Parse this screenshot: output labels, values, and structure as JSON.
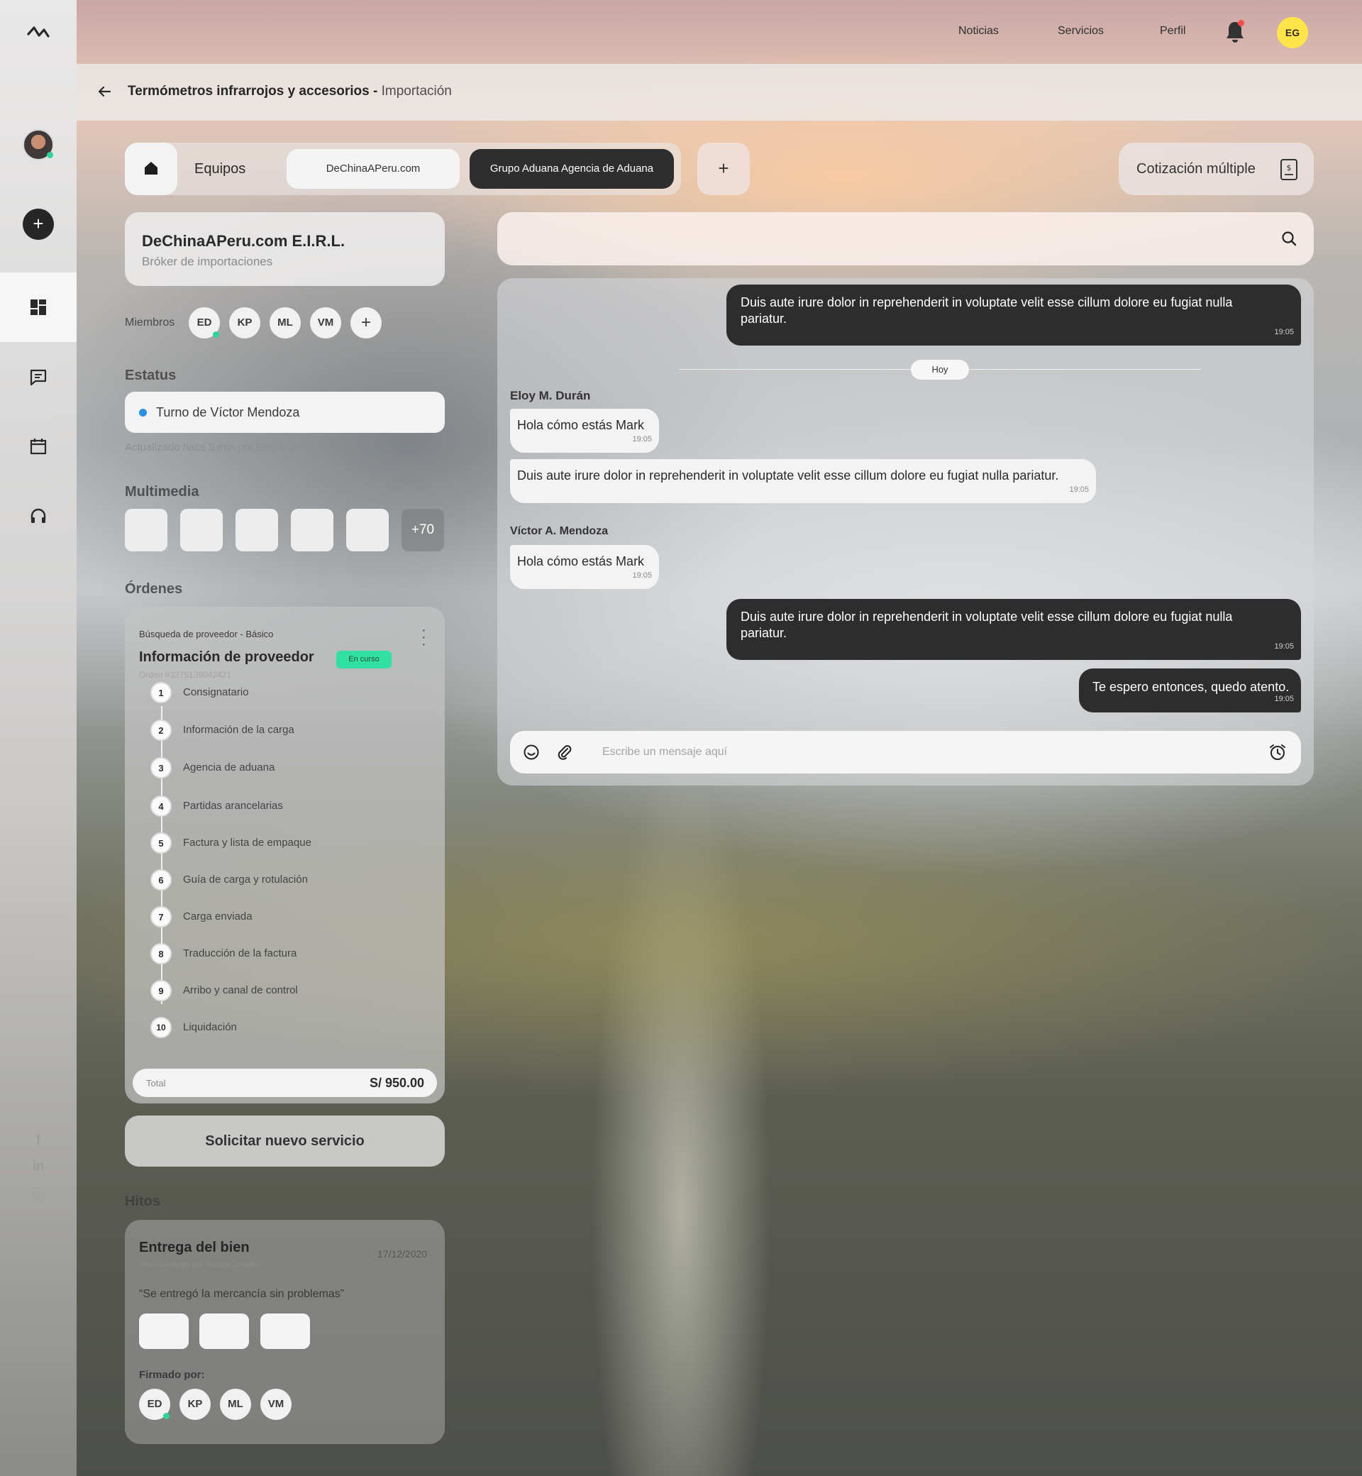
{
  "nav": {
    "links": [
      "Noticias",
      "Servicios",
      "Perfil"
    ],
    "user_initials": "EG",
    "bell_icon": "bell-icon"
  },
  "breadcrumb": {
    "title": "Termómetros infrarrojos y accesorios -",
    "subtitle": "Importación"
  },
  "tabs": {
    "group_label": "Equipos",
    "items": [
      "DeChinaAPeru.com",
      "Grupo Aduana Agencia de Aduana"
    ],
    "active_index": 1,
    "multi_quote_label": "Cotización múltiple"
  },
  "company": {
    "name": "DeChinaAPeru.com E.I.R.L.",
    "role": "Bróker de importaciones"
  },
  "members": {
    "label": "Miembros",
    "initials": [
      "ED",
      "KP",
      "ML",
      "VM"
    ]
  },
  "status": {
    "heading": "Estatus",
    "value": "Turno de Víctor Mendoza",
    "updated": "Actualizado hace 5 min por Eloy Durán"
  },
  "media": {
    "heading": "Multimedia",
    "more_count": "+70"
  },
  "orders": {
    "heading": "Órdenes",
    "category": "Búsqueda de proveedor - Básico",
    "title": "Información de proveedor",
    "badge": "En curso",
    "order_number": "Orden #3275139042421",
    "steps": [
      {
        "n": "1",
        "label": "Consignatario"
      },
      {
        "n": "2",
        "label": "Información de la carga"
      },
      {
        "n": "3",
        "label": "Agencia de aduana"
      },
      {
        "n": "4",
        "label": "Partidas arancelarias"
      },
      {
        "n": "5",
        "label": "Factura y lista de empaque"
      },
      {
        "n": "6",
        "label": "Guía de carga y rotulación"
      },
      {
        "n": "7",
        "label": "Carga enviada"
      },
      {
        "n": "8",
        "label": "Traducción de la factura"
      },
      {
        "n": "9",
        "label": "Arribo y canal de control"
      },
      {
        "n": "10",
        "label": "Liquidación"
      }
    ],
    "total_label": "Total",
    "total_value": "S/ 950.00"
  },
  "request_button": "Solicitar nuevo servicio",
  "milestones": {
    "heading": "Hitos",
    "title": "Entrega del bien",
    "date": "17/12/2020",
    "meta": "Hito #1 creado por Julissa Zevallos",
    "quote": "“Se entregó la mercancía sin problemas”",
    "signed_label": "Firmado por:",
    "signers": [
      "ED",
      "KP",
      "ML",
      "VM"
    ]
  },
  "chat": {
    "search_placeholder": "",
    "today_label": "Hoy",
    "messages": [
      {
        "dir": "out",
        "text": "Duis aute irure dolor in reprehenderit in voluptate velit esse cillum dolore eu fugiat nulla pariatur.",
        "time": "19:05"
      },
      {
        "dir": "in",
        "sender": "Eloy M. Durán",
        "text": "Hola cómo estás Mark",
        "time": "19:05"
      },
      {
        "dir": "in",
        "text": "Duis aute irure dolor in reprehenderit in voluptate velit esse cillum dolore eu fugiat nulla pariatur.",
        "time": "19:05"
      },
      {
        "dir": "in",
        "sender": "Víctor A. Mendoza",
        "text": "Hola cómo estás Mark",
        "time": "19:05"
      },
      {
        "dir": "out",
        "text": "Duis aute irure dolor in reprehenderit in voluptate velit esse cillum dolore eu fugiat nulla pariatur.",
        "time": "19:05"
      },
      {
        "dir": "out",
        "text": "Te espero entonces, quedo atento.",
        "time": "19:05"
      }
    ],
    "composer_placeholder": "Escribe un mensaje aquí"
  },
  "colors": {
    "accent_dark": "#2d2d2d",
    "status_blue": "#2d8fe0",
    "online_green": "#2fd39a",
    "badge_green": "#33e0a3",
    "avatar_yellow": "#ffe44a",
    "notification_red": "#ff4d4d"
  }
}
